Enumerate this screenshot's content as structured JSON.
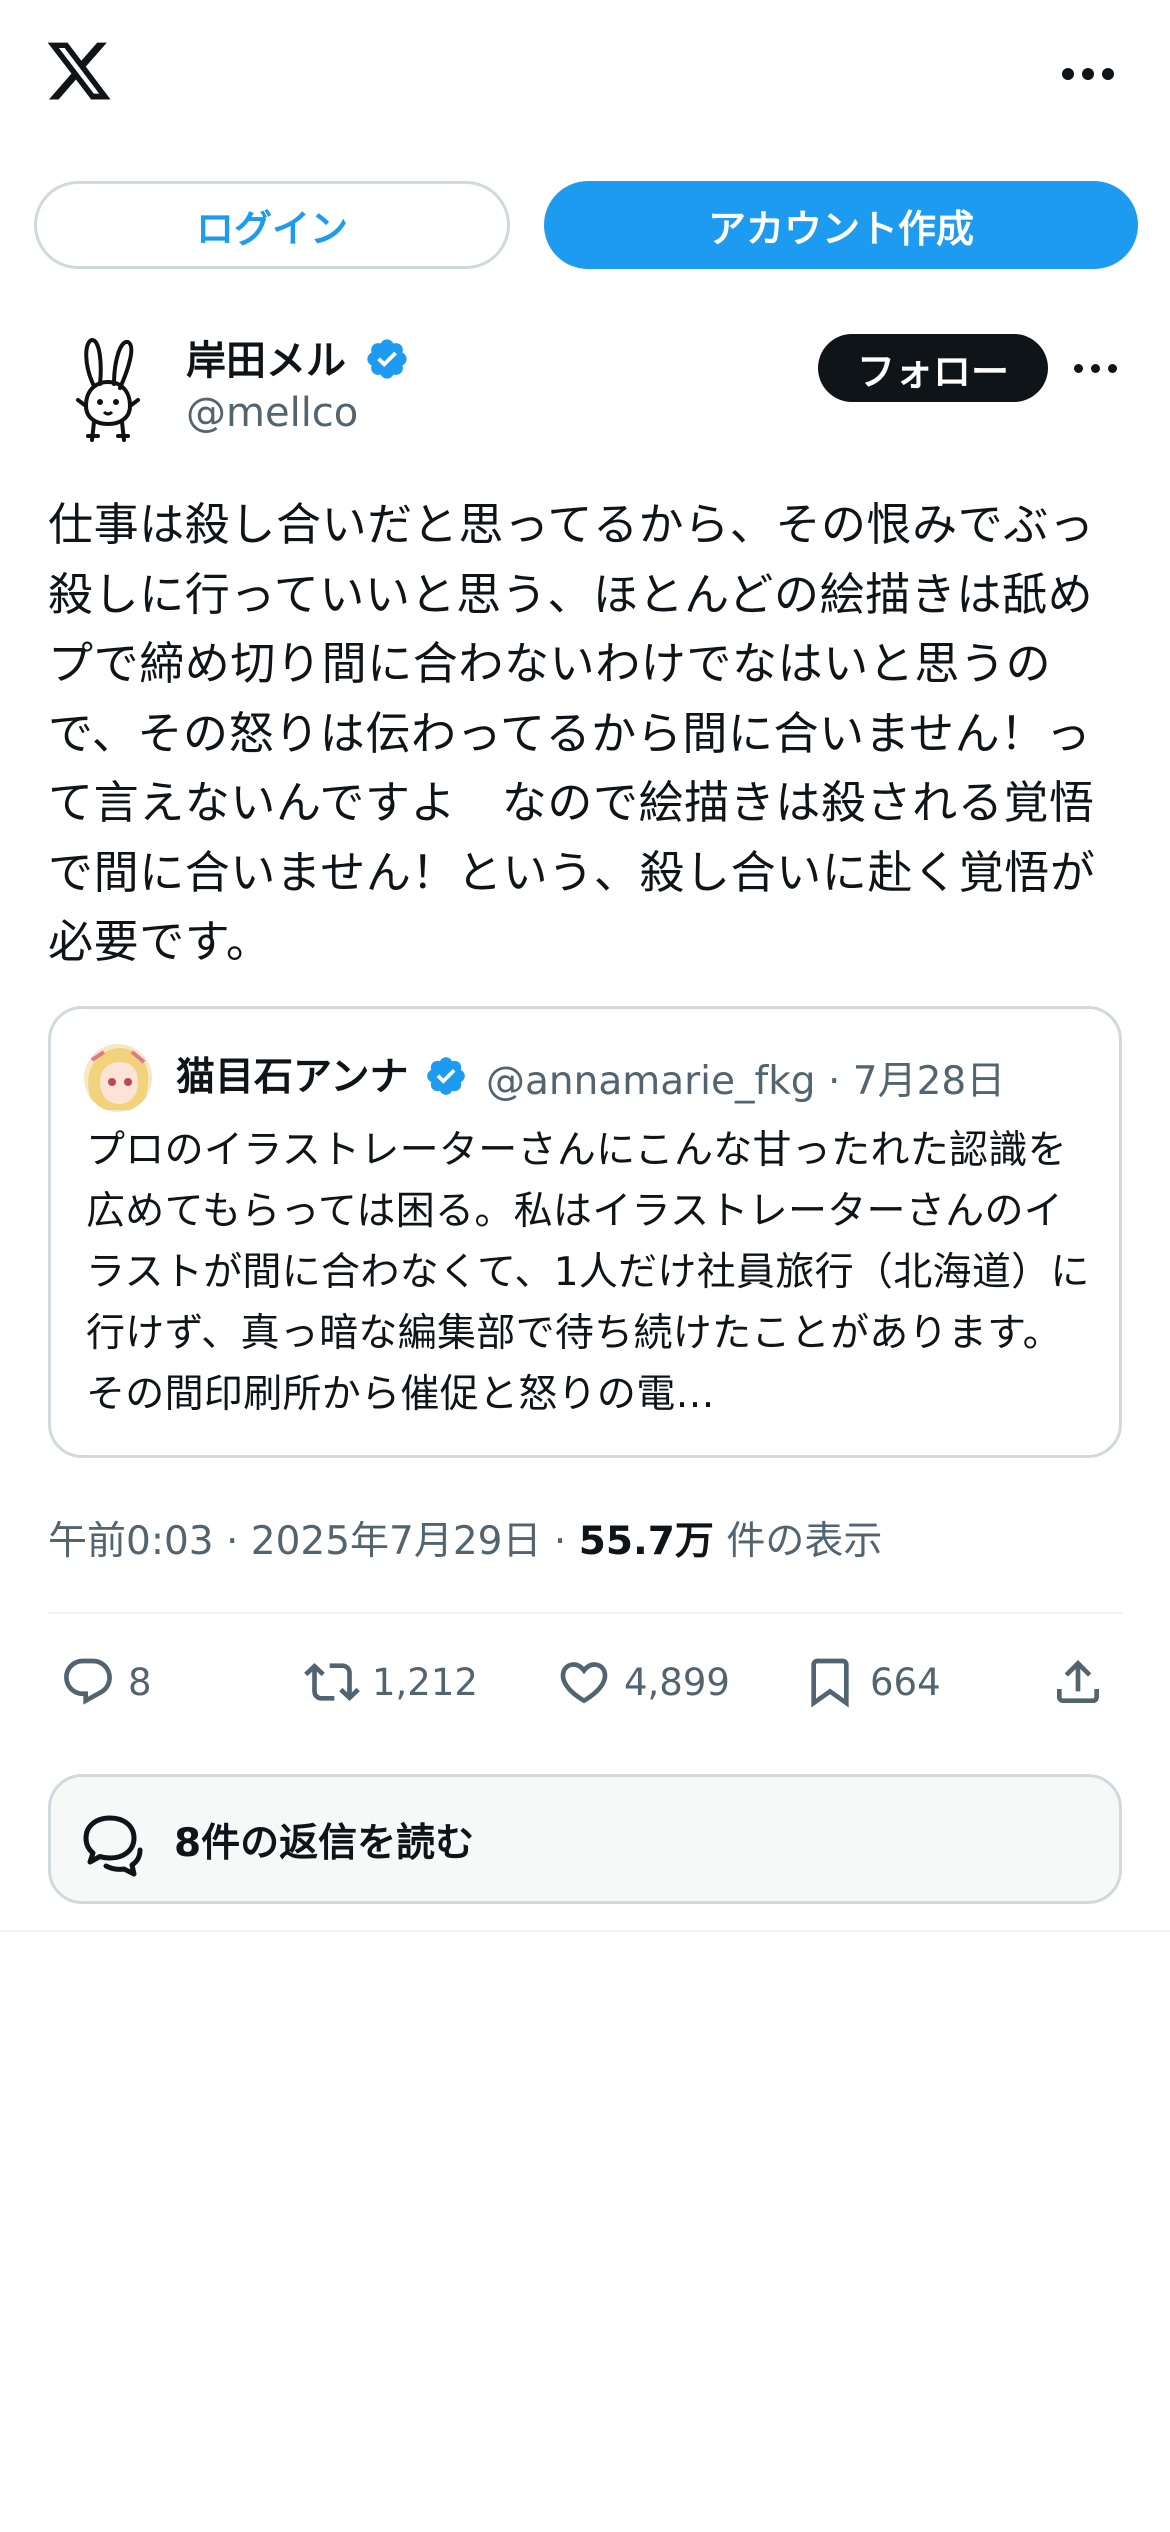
{
  "header": {
    "logo_icon": "x-logo-icon",
    "more_icon": "more-horizontal-icon"
  },
  "auth": {
    "login_label": "ログイン",
    "signup_label": "アカウント作成"
  },
  "post": {
    "author": {
      "display_name": "岸田メル",
      "handle": "@mellco",
      "verified": true
    },
    "follow_label": "フォロー",
    "text": "仕事は殺し合いだと思ってるから、その恨みでぶっ殺しに行っていいと思う、ほとんどの絵描きは舐めプで締め切り間に合わないわけでなはいと思うので、その怒りは伝わってるから間に合いません！って言えないんですよ　なので絵描きは殺される覚悟で間に合いません！という、殺し合いに赴く覚悟が必要です。",
    "quote": {
      "display_name": "猫目石アンナ",
      "handle": "@annamarie_fkg",
      "separator": "·",
      "date": "7月28日",
      "text": "プロのイラストレーターさんにこんな甘ったれた認識を広めてもらっては困る。私はイラストレーターさんのイラストが間に合わなくて、1人だけ社員旅行（北海道）に行けず、真っ暗な編集部で待ち続けたことがあります。その間印刷所から催促と怒りの電…"
    },
    "meta": {
      "time": "午前0:03",
      "sep1": " · ",
      "date": "2025年7月29日",
      "sep2": " · ",
      "views": "55.7万",
      "views_label": " 件の表示"
    },
    "actions": {
      "replies": "8",
      "reposts": "1,212",
      "likes": "4,899",
      "bookmarks": "664"
    },
    "read_replies_label": "8件の返信を読む"
  },
  "colors": {
    "accent": "#1d9bf0",
    "text": "#0f1419",
    "secondary": "#536471",
    "border": "#cfd9de"
  }
}
